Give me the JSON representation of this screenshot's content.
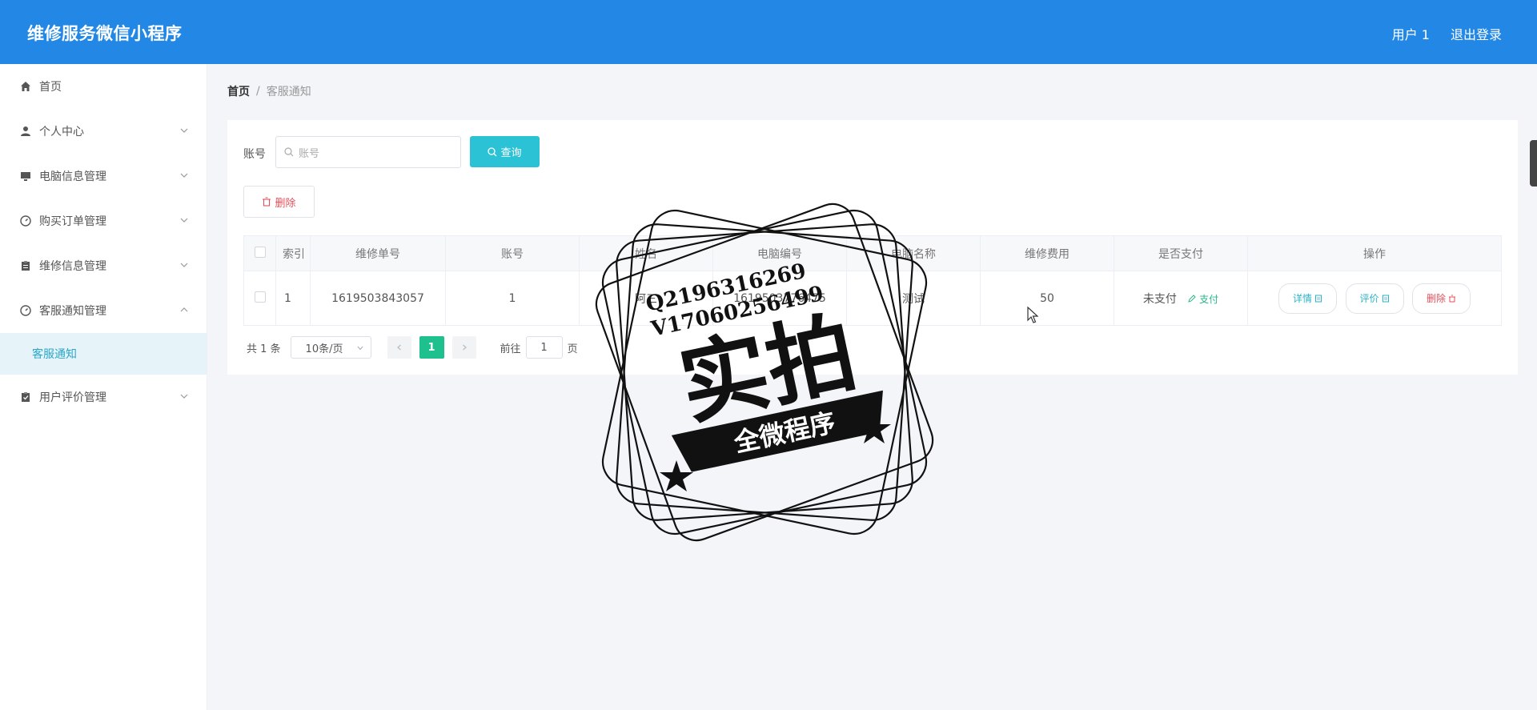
{
  "header": {
    "app_title": "维修服务微信小程序",
    "user": "用户 1",
    "logout": "退出登录"
  },
  "sidebar": {
    "items": [
      {
        "label": "首页",
        "icon": "home-icon"
      },
      {
        "label": "个人中心",
        "icon": "user-icon"
      },
      {
        "label": "电脑信息管理",
        "icon": "monitor-icon"
      },
      {
        "label": "购买订单管理",
        "icon": "compass-icon"
      },
      {
        "label": "维修信息管理",
        "icon": "clipboard-icon"
      },
      {
        "label": "客服通知管理",
        "icon": "compass-icon",
        "expanded": true
      },
      {
        "label": "用户评价管理",
        "icon": "clipboard-check-icon"
      }
    ],
    "submenu": {
      "label": "客服通知"
    }
  },
  "breadcrumb": {
    "home": "首页",
    "sep": "/",
    "current": "客服通知"
  },
  "search": {
    "label": "账号",
    "placeholder": "账号",
    "button": "查询"
  },
  "toolbar": {
    "delete_label": "删除"
  },
  "table": {
    "headers": [
      "索引",
      "维修单号",
      "账号",
      "姓名",
      "电脑编号",
      "电脑名称",
      "维修费用",
      "是否支付",
      "操作"
    ],
    "rows": [
      {
        "index": "1",
        "order_no": "1619503843057",
        "account": "1",
        "name": "阿三",
        "pc_no": "1619503776475",
        "pc_name": "测试",
        "fee": "50",
        "paid": "未支付",
        "pay_link": "支付"
      }
    ],
    "actions": {
      "detail": "详情",
      "eval": "评价",
      "delete": "删除"
    }
  },
  "pager": {
    "total": "共 1 条",
    "page_size": "10条/页",
    "current_page": "1",
    "goto_label": "前往",
    "goto_value": "1",
    "page_suffix": "页"
  },
  "watermark": {
    "line1": "Q2196316269",
    "line2": "V17060256499",
    "main": "实拍",
    "banner": "全微程序"
  },
  "colors": {
    "header": "#2388e5",
    "accent": "#2cc2d6",
    "active_page": "#1ec08e",
    "danger": "#e0515b"
  }
}
